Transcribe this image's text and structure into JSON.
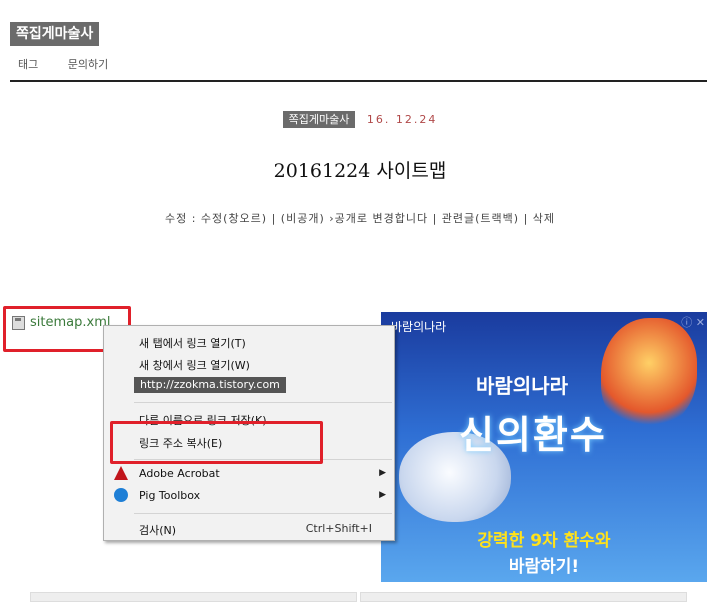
{
  "blog": {
    "title": "쪽집게마술사"
  },
  "nav": {
    "items": [
      "태그",
      "문의하기"
    ]
  },
  "post": {
    "category": "쪽집게마술사",
    "date": "16. 12.24",
    "title": "20161224 사이트맵",
    "actions": "수정 : 수정(창오르) | (비공개) ›공개로 변경합니다 | 관련글(트랙백) | 삭제",
    "attachment": "sitemap.xml"
  },
  "context_menu": {
    "open_new_tab": "새 탭에서 링크 열기(T)",
    "open_new_window": "새 창에서 링크 열기(W)",
    "url": "http://zzokma.tistory.com",
    "save_as": "다른 이름으로 링크 저장(K)",
    "copy_link": "링크 주소 복사(E)",
    "acrobat": "Adobe Acrobat",
    "pig": "Pig Toolbox",
    "inspect": "검사(N)",
    "inspect_shortcut": "Ctrl+Shift+I"
  },
  "ad": {
    "logo": "바람의나라",
    "title1": "바람의나라",
    "title2": "신의환수",
    "line1": "강력한 9차 환수와",
    "line2": "바람하기!",
    "controls": "ⓘ ✕"
  },
  "colors": {
    "highlight": "#e0202a",
    "accent_date": "#b04848"
  }
}
